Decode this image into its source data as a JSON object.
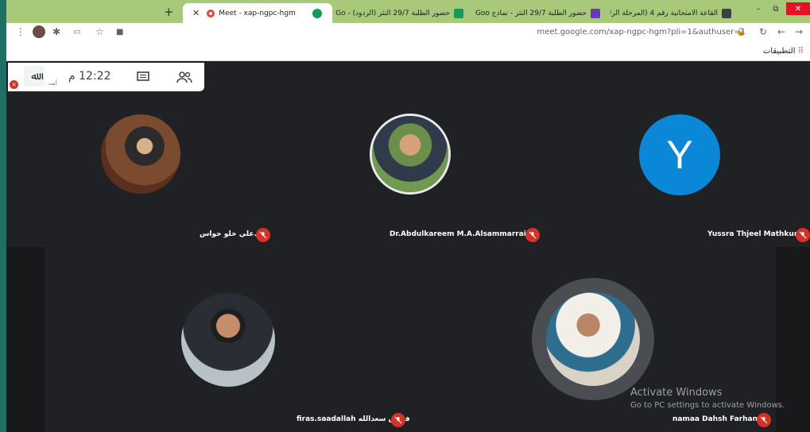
{
  "browser": {
    "tabs": [
      {
        "label": "القاعة الامتحانية رقم 4 (المرحلة الرا",
        "color": "#3c4043"
      },
      {
        "label": "حضور الطلبة 29/7 النثر - نماذج Goo",
        "color": "#673ab7"
      },
      {
        "label": "حضور الطلبة 29/7 النثر (الردود) - Go",
        "color": "#0f9d58"
      },
      {
        "label": "Meet - xap-ngpc-hgm",
        "color": "#ea4335"
      }
    ],
    "new_tab": "+",
    "url": "meet.google.com/xap-ngpc-hgm?pli=1&authuser=1",
    "bookmarks_label": "التطبيقات"
  },
  "meeting": {
    "time": "12:22 م",
    "self_label": "أنت"
  },
  "participants": [
    {
      "name": "ا.د.علي خلو حواس",
      "avatar": "photo"
    },
    {
      "name": "Dr.Abdulkareem M.A.Alsammarraie",
      "avatar": "photo"
    },
    {
      "name": "Yussra Thjeel Mathkur",
      "avatar": "letter",
      "letter": "Y",
      "color": "#0b87d8"
    },
    {
      "name": "firas.saadallah فراس سعدالله",
      "avatar": "photo"
    },
    {
      "name": "namaa Dahsh Farhan",
      "avatar": "photo"
    }
  ],
  "watermark": {
    "title": "Activate Windows",
    "subtitle": "Go to PC settings to activate Windows."
  },
  "colors": {
    "mute_red": "#d93025",
    "meet_bg": "#202124",
    "tab_strip": "#a8c97a"
  }
}
